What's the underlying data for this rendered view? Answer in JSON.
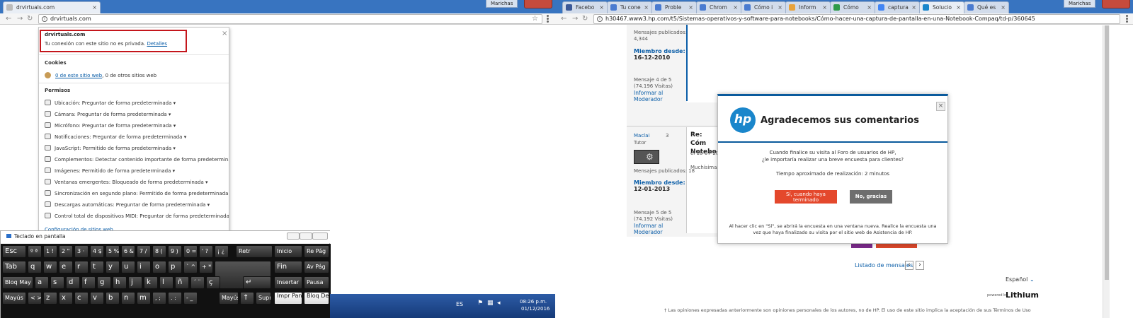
{
  "left_browser": {
    "tab": {
      "title": "drvirtuals.com"
    },
    "user": "Marichas",
    "url": "drvirtuals.com",
    "popup": {
      "site": "drvirtuals.com",
      "privacy_msg": "Tu conexión con este sitio no es privada.",
      "details_link": "Detalles",
      "cookies_title": "Cookies",
      "cookies_this": "0 de este sitio web",
      "cookies_other": ", 0 de otros sitios web",
      "permisos_title": "Permisos",
      "permissions": [
        {
          "label": "Ubicación:",
          "value": "Preguntar de forma predeterminada",
          "icon": "location-icon"
        },
        {
          "label": "Cámara:",
          "value": "Preguntar de forma predeterminada",
          "icon": "camera-icon"
        },
        {
          "label": "Micrófono:",
          "value": "Preguntar de forma predeterminada",
          "icon": "microphone-icon"
        },
        {
          "label": "Notificaciones:",
          "value": "Preguntar de forma predeterminada",
          "icon": "notification-icon"
        },
        {
          "label": "JavaScript:",
          "value": "Permitido de forma predeterminada",
          "icon": "javascript-icon"
        },
        {
          "label": "Complementos:",
          "value": "Detectar contenido importante de forma predeterminada",
          "icon": "plugin-icon"
        },
        {
          "label": "Imágenes:",
          "value": "Permitido de forma predeterminada",
          "icon": "image-icon"
        },
        {
          "label": "Ventanas emergentes:",
          "value": "Bloqueado de forma predeterminada",
          "icon": "popup-icon"
        },
        {
          "label": "Sincronización en segundo plano:",
          "value": "Permitido de forma predeterminada",
          "icon": "sync-icon"
        },
        {
          "label": "Descargas automáticas:",
          "value": "Preguntar de forma predeterminada",
          "icon": "download-icon"
        },
        {
          "label": "Control total de dispositivos MIDI:",
          "value": "Preguntar de forma predeterminada",
          "icon": "midi-icon"
        }
      ],
      "settings_link": "Configuración de sitios web"
    }
  },
  "keyboard": {
    "title": "Teclado en pantalla",
    "rows": [
      [
        "Esc",
        "º ª",
        "1 !",
        "2 \"",
        "3 ·",
        "4 $",
        "5 %",
        "6 &",
        "7 /",
        "8 (",
        "9 )",
        "0 =",
        "' ?",
        "¡ ¿",
        "Retr",
        "Inicio",
        "Re Pág"
      ],
      [
        "Tab",
        "q",
        "w",
        "e",
        "r",
        "t",
        "y",
        "u",
        "i",
        "o",
        "p",
        "` ^",
        "+ *",
        "",
        "Fin",
        "Av Pág"
      ],
      [
        "Bloq May",
        "a",
        "s",
        "d",
        "f",
        "g",
        "h",
        "j",
        "k",
        "l",
        "ñ",
        "´ ¨",
        "ç",
        "↵",
        "Insertar",
        "Pausa"
      ],
      [
        "Mayús",
        "< >",
        "z",
        "x",
        "c",
        "v",
        "b",
        "n",
        "m",
        ", ;",
        ". :",
        "- _",
        "Mayús",
        "↑",
        "Supr",
        "Impr Pant",
        "Bloq Despl"
      ]
    ]
  },
  "taskbar": {
    "lang": "ES",
    "time": "08:26 p.m.",
    "date": "01/12/2016"
  },
  "right_browser": {
    "tabs": [
      "Facebo",
      "Tu cone",
      "Proble",
      "Chrom",
      "Cómo i",
      "Inform",
      "Cómo",
      "captura",
      "Solucio",
      "Qué es"
    ],
    "user": "Marichas",
    "url": "h30467.www3.hp.com/t5/Sistemas-operativos-y-software-para-notebooks/Cómo-hacer-una-captura-de-pantalla-en-una-Notebook-Compaq/td-p/360645",
    "post1": {
      "published_label": "Mensajes publicados:",
      "published": "4,344",
      "member_label": "Miembro desde:",
      "member_since": "16-12-2010",
      "msg": "Mensaje 4 de 5",
      "views": "(74.196 Visitas)",
      "report": "Informar al Moderador"
    },
    "post2": {
      "user": "Maclai",
      "rank_num": "3",
      "role": "Tutor",
      "published": "Mensajes publicados: 18",
      "member_label": "Miembro desde:",
      "member_since": "12-01-2013",
      "msg": "Mensaje 5 de 5",
      "views": "(74.192 Visitas)",
      "report": "Informar al Moderador",
      "title": "Re: Cóm Notebo",
      "date": "el 16-07-201",
      "body": "Muchísimas"
    },
    "listado": "Listado de mensajes",
    "lang": "Español",
    "powered": "powered by",
    "brand": "Lithium",
    "footer": "† Las opiniones expresadas anteriormente son opiniones personales de los autores, no de HP. El uso de este sitio implica la aceptación de sus Términos de Uso y Reglas de Participación",
    "survey": {
      "logo": "hp",
      "title": "Agradecemos sus comentarios",
      "q1": "Cuando finalice su visita al Foro de usuarios de HP,",
      "q2": "¿le importaría realizar una breve encuesta para clientes?",
      "time": "Tiempo aproximado de realización: 2 minutos",
      "yes": "Sí, cuando haya terminado",
      "no": "No, gracias",
      "note1": "Al hacer clic en \"Sí\", se abrirá la encuesta en una ventana nueva. Realice la encuesta una",
      "note2": "vez que haya finalizado su visita por el sitio web de Asistencia de HP.",
      "close": "×"
    }
  }
}
